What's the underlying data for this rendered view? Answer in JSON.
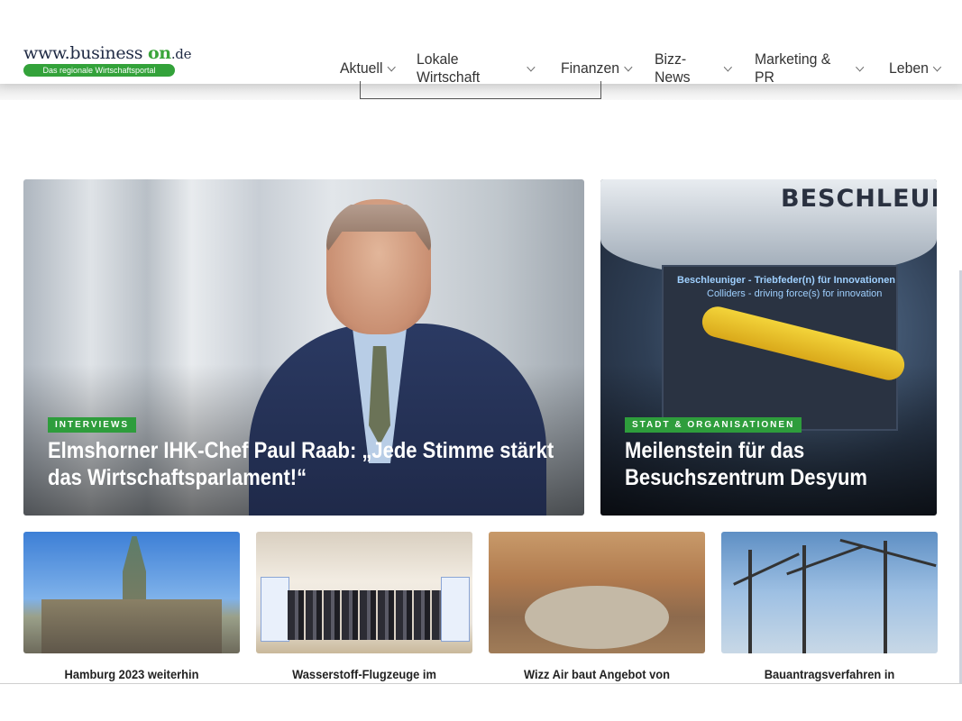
{
  "logo": {
    "www": "www.",
    "business": "business",
    "on": "on",
    "tld": ".de",
    "tagline": "Das regionale Wirtschaftsportal"
  },
  "nav": [
    {
      "label": "Aktuell"
    },
    {
      "label": "Lokale Wirtschaft"
    },
    {
      "label": "Finanzen"
    },
    {
      "label": "Bizz-News"
    },
    {
      "label": "Marketing & PR"
    },
    {
      "label": "Leben"
    }
  ],
  "featured": [
    {
      "tag": "INTERVIEWS",
      "title": "Elmshorner IHK-Chef Paul Raab: „Jede Stimme stärkt das Wirtschaftsparlament!“"
    },
    {
      "tag": "STADT & ORGANISATIONEN",
      "title": "Meilenstein für das Besuchszentrum Desyum",
      "image_text": {
        "dome": "BESCHLEUNIG",
        "screen_title": "Beschleuniger - Triebfeder(n) für Innovationen",
        "screen_subtitle": "Colliders - driving force(s) for innovation"
      }
    }
  ],
  "cards": [
    {
      "title": "Hamburg 2023 weiterhin"
    },
    {
      "title": "Wasserstoff-Flugzeuge im"
    },
    {
      "title": "Wizz Air baut Angebot von"
    },
    {
      "title": "Bauantragsverfahren in"
    }
  ],
  "colors": {
    "accent": "#2e9d3c",
    "logo_blue": "#1f2a44"
  }
}
